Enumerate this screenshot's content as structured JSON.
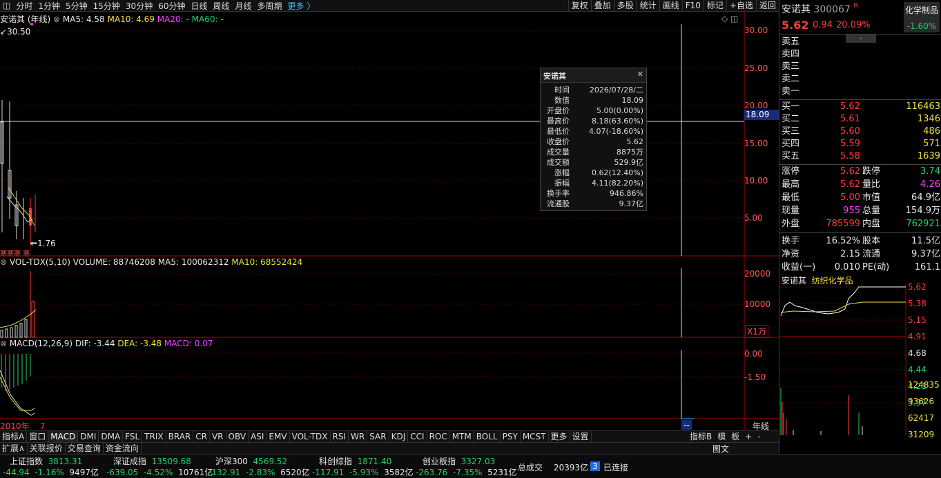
{
  "toolbar": {
    "items": [
      "分时",
      "1分钟",
      "5分钟",
      "15分钟",
      "30分钟",
      "60分钟",
      "日线",
      "周线",
      "月线",
      "多周期",
      "更多 〉"
    ],
    "right": [
      "复权",
      "叠加",
      "多股",
      "统计",
      "画线",
      "F10",
      "标记",
      "+自选",
      "返回"
    ]
  },
  "main_panel": {
    "title": "安诺其 (年线)",
    "ma5": "MA5: 4.58",
    "ma10": "MA10: 4.69",
    "ma20": "MA20: -",
    "ma60": "MA60: -",
    "high_mark": "30.50",
    "low_mark": "1.76",
    "y_ticks": [
      "30.00",
      "25.00",
      "20.00",
      "15.00",
      "10.00",
      "5.00"
    ],
    "cross_value": "18.09",
    "xmark_label": "寒寒寒",
    "xmark_label2": "寒"
  },
  "vol_panel": {
    "title": "VOL-TDX(5,10)",
    "volume": "VOLUME: 88746208",
    "ma5": "MA5: 100062312",
    "ma10": "MA10: 68552424",
    "y_ticks": [
      "20000",
      "10000"
    ],
    "unit": "X1万"
  },
  "macd_panel": {
    "title": "MACD(12,26,9)",
    "dif": "DIF: -3.44",
    "dea": "DEA: -3.48",
    "macd": "MACD: 0.07",
    "y_ticks": [
      "0.00",
      "-1.50"
    ]
  },
  "x_axis": {
    "left": "2010年",
    "left2": "7",
    "cursor": "--",
    "period": "年线"
  },
  "popup": {
    "title": "安诺其",
    "close": "✕",
    "rows": [
      {
        "k": "时间",
        "v": "2026/07/28/二",
        "c": "wht"
      },
      {
        "k": "数值",
        "v": "18.09",
        "c": "wht"
      },
      {
        "k": "开盘价",
        "v": "5.00(0.00%)",
        "c": "wht"
      },
      {
        "k": "最高价",
        "v": "8.18(63.60%)",
        "c": "red"
      },
      {
        "k": "最低价",
        "v": "4.07(-18.60%)",
        "c": "grn"
      },
      {
        "k": "收盘价",
        "v": "5.62",
        "c": "red"
      },
      {
        "k": "成交量",
        "v": "8875万",
        "c": "wht"
      },
      {
        "k": "成交额",
        "v": "529.9亿",
        "c": "wht"
      },
      {
        "k": "涨幅",
        "v": "0.62(12.40%)",
        "c": "red"
      },
      {
        "k": "振幅",
        "v": "4.11(82.20%)",
        "c": "wht"
      },
      {
        "k": "换手率",
        "v": "946.86%",
        "c": "wht"
      },
      {
        "k": "流通股",
        "v": "9.37亿",
        "c": "wht"
      }
    ]
  },
  "tabs": [
    "指标A",
    "窗口",
    "MACD",
    "DMI",
    "DMA",
    "FSL",
    "TRIX",
    "BRAR",
    "CR",
    "VR",
    "OBV",
    "ASI",
    "EMV",
    "VOL-TDX",
    "RSI",
    "WR",
    "SAR",
    "KDJ",
    "CCI",
    "ROC",
    "MTM",
    "BOLL",
    "PSY",
    "MCST",
    "更多",
    "设置"
  ],
  "tabs_right": [
    "指标B",
    "模",
    "板",
    "+",
    "-"
  ],
  "tabs2": [
    "扩展∧",
    "关联报价",
    "交易查询",
    "资金流向"
  ],
  "tabs2_right": "图文",
  "status": {
    "indices": [
      {
        "name": "上证指数",
        "val": "3813.31",
        "chg": "-44.94",
        "pct": "-1.16%",
        "amt": "9497亿"
      },
      {
        "name": "深证成指",
        "val": "13509.68",
        "chg": "-639.05",
        "pct": "-4.52%",
        "amt": "10761亿"
      },
      {
        "name": "沪深300",
        "val": "4569.52",
        "chg": "-132.91",
        "pct": "-2.83%",
        "amt": "6520亿"
      },
      {
        "name": "科创综指",
        "val": "1871.40",
        "chg": "-117.91",
        "pct": "-5.93%",
        "amt": "3582亿"
      },
      {
        "name": "创业板指",
        "val": "3327.03",
        "chg": "-263.76",
        "pct": "-7.35%",
        "amt": "5231亿"
      }
    ],
    "total_label": "总成交",
    "total": "20393亿",
    "conn_num": "3",
    "conn": "已连接"
  },
  "quote": {
    "name": "安诺其",
    "code": "300067",
    "flag": "R",
    "sector": "化学制品",
    "sector_pct": "-1.60%",
    "price": "5.62",
    "chg": "0.94",
    "pct": "20.09%",
    "sell": [
      {
        "k": "卖五"
      },
      {
        "k": "卖四"
      },
      {
        "k": "卖三"
      },
      {
        "k": "卖二"
      },
      {
        "k": "卖一"
      }
    ],
    "buy": [
      {
        "k": "买一",
        "p": "5.62",
        "v": "116463"
      },
      {
        "k": "买二",
        "p": "5.61",
        "v": "1346"
      },
      {
        "k": "买三",
        "p": "5.60",
        "v": "486"
      },
      {
        "k": "买四",
        "p": "5.59",
        "v": "571"
      },
      {
        "k": "买五",
        "p": "5.58",
        "v": "1639"
      }
    ],
    "stats": [
      {
        "k1": "涨停",
        "v1": "5.62",
        "c1": "red",
        "k2": "跌停",
        "v2": "3.74",
        "c2": "grn"
      },
      {
        "k1": "最高",
        "v1": "5.62",
        "c1": "red",
        "k2": "量比",
        "v2": "4.26",
        "c2": "mag"
      },
      {
        "k1": "最低",
        "v1": "5.00",
        "c1": "red",
        "k2": "市值",
        "v2": "64.9亿",
        "c2": "wht"
      },
      {
        "k1": "现量",
        "v1": "955",
        "c1": "mag",
        "k2": "总量",
        "v2": "154.9万",
        "c2": "wht"
      },
      {
        "k1": "外盘",
        "v1": "785599",
        "c1": "red",
        "k2": "内盘",
        "v2": "762921",
        "c2": "grn"
      }
    ],
    "stats2": [
      {
        "k1": "换手",
        "v1": "16.52%",
        "c1": "wht",
        "k2": "股本",
        "v2": "11.5亿",
        "c2": "wht"
      },
      {
        "k1": "净资",
        "v1": "2.15",
        "c1": "wht",
        "k2": "流通",
        "v2": "9.37亿",
        "c2": "wht"
      },
      {
        "k1": "收益(一)",
        "v1": "0.010",
        "c1": "wht",
        "k2": "PE(动)",
        "v2": "161.1",
        "c2": "wht"
      }
    ],
    "mini_title": "安诺其",
    "mini_sector": "纺织化学品",
    "mini_ticks": [
      "5.62",
      "5.38",
      "5.15",
      "4.91",
      "4.68",
      "4.44",
      "4.21",
      "3.97"
    ],
    "mini_vol_ticks": [
      "124835",
      "93626",
      "62417",
      "31209"
    ]
  },
  "colors": {
    "up": "#ff3b3b",
    "down": "#22d26a",
    "grid": "#5a0000",
    "axis": "#aa0000"
  }
}
